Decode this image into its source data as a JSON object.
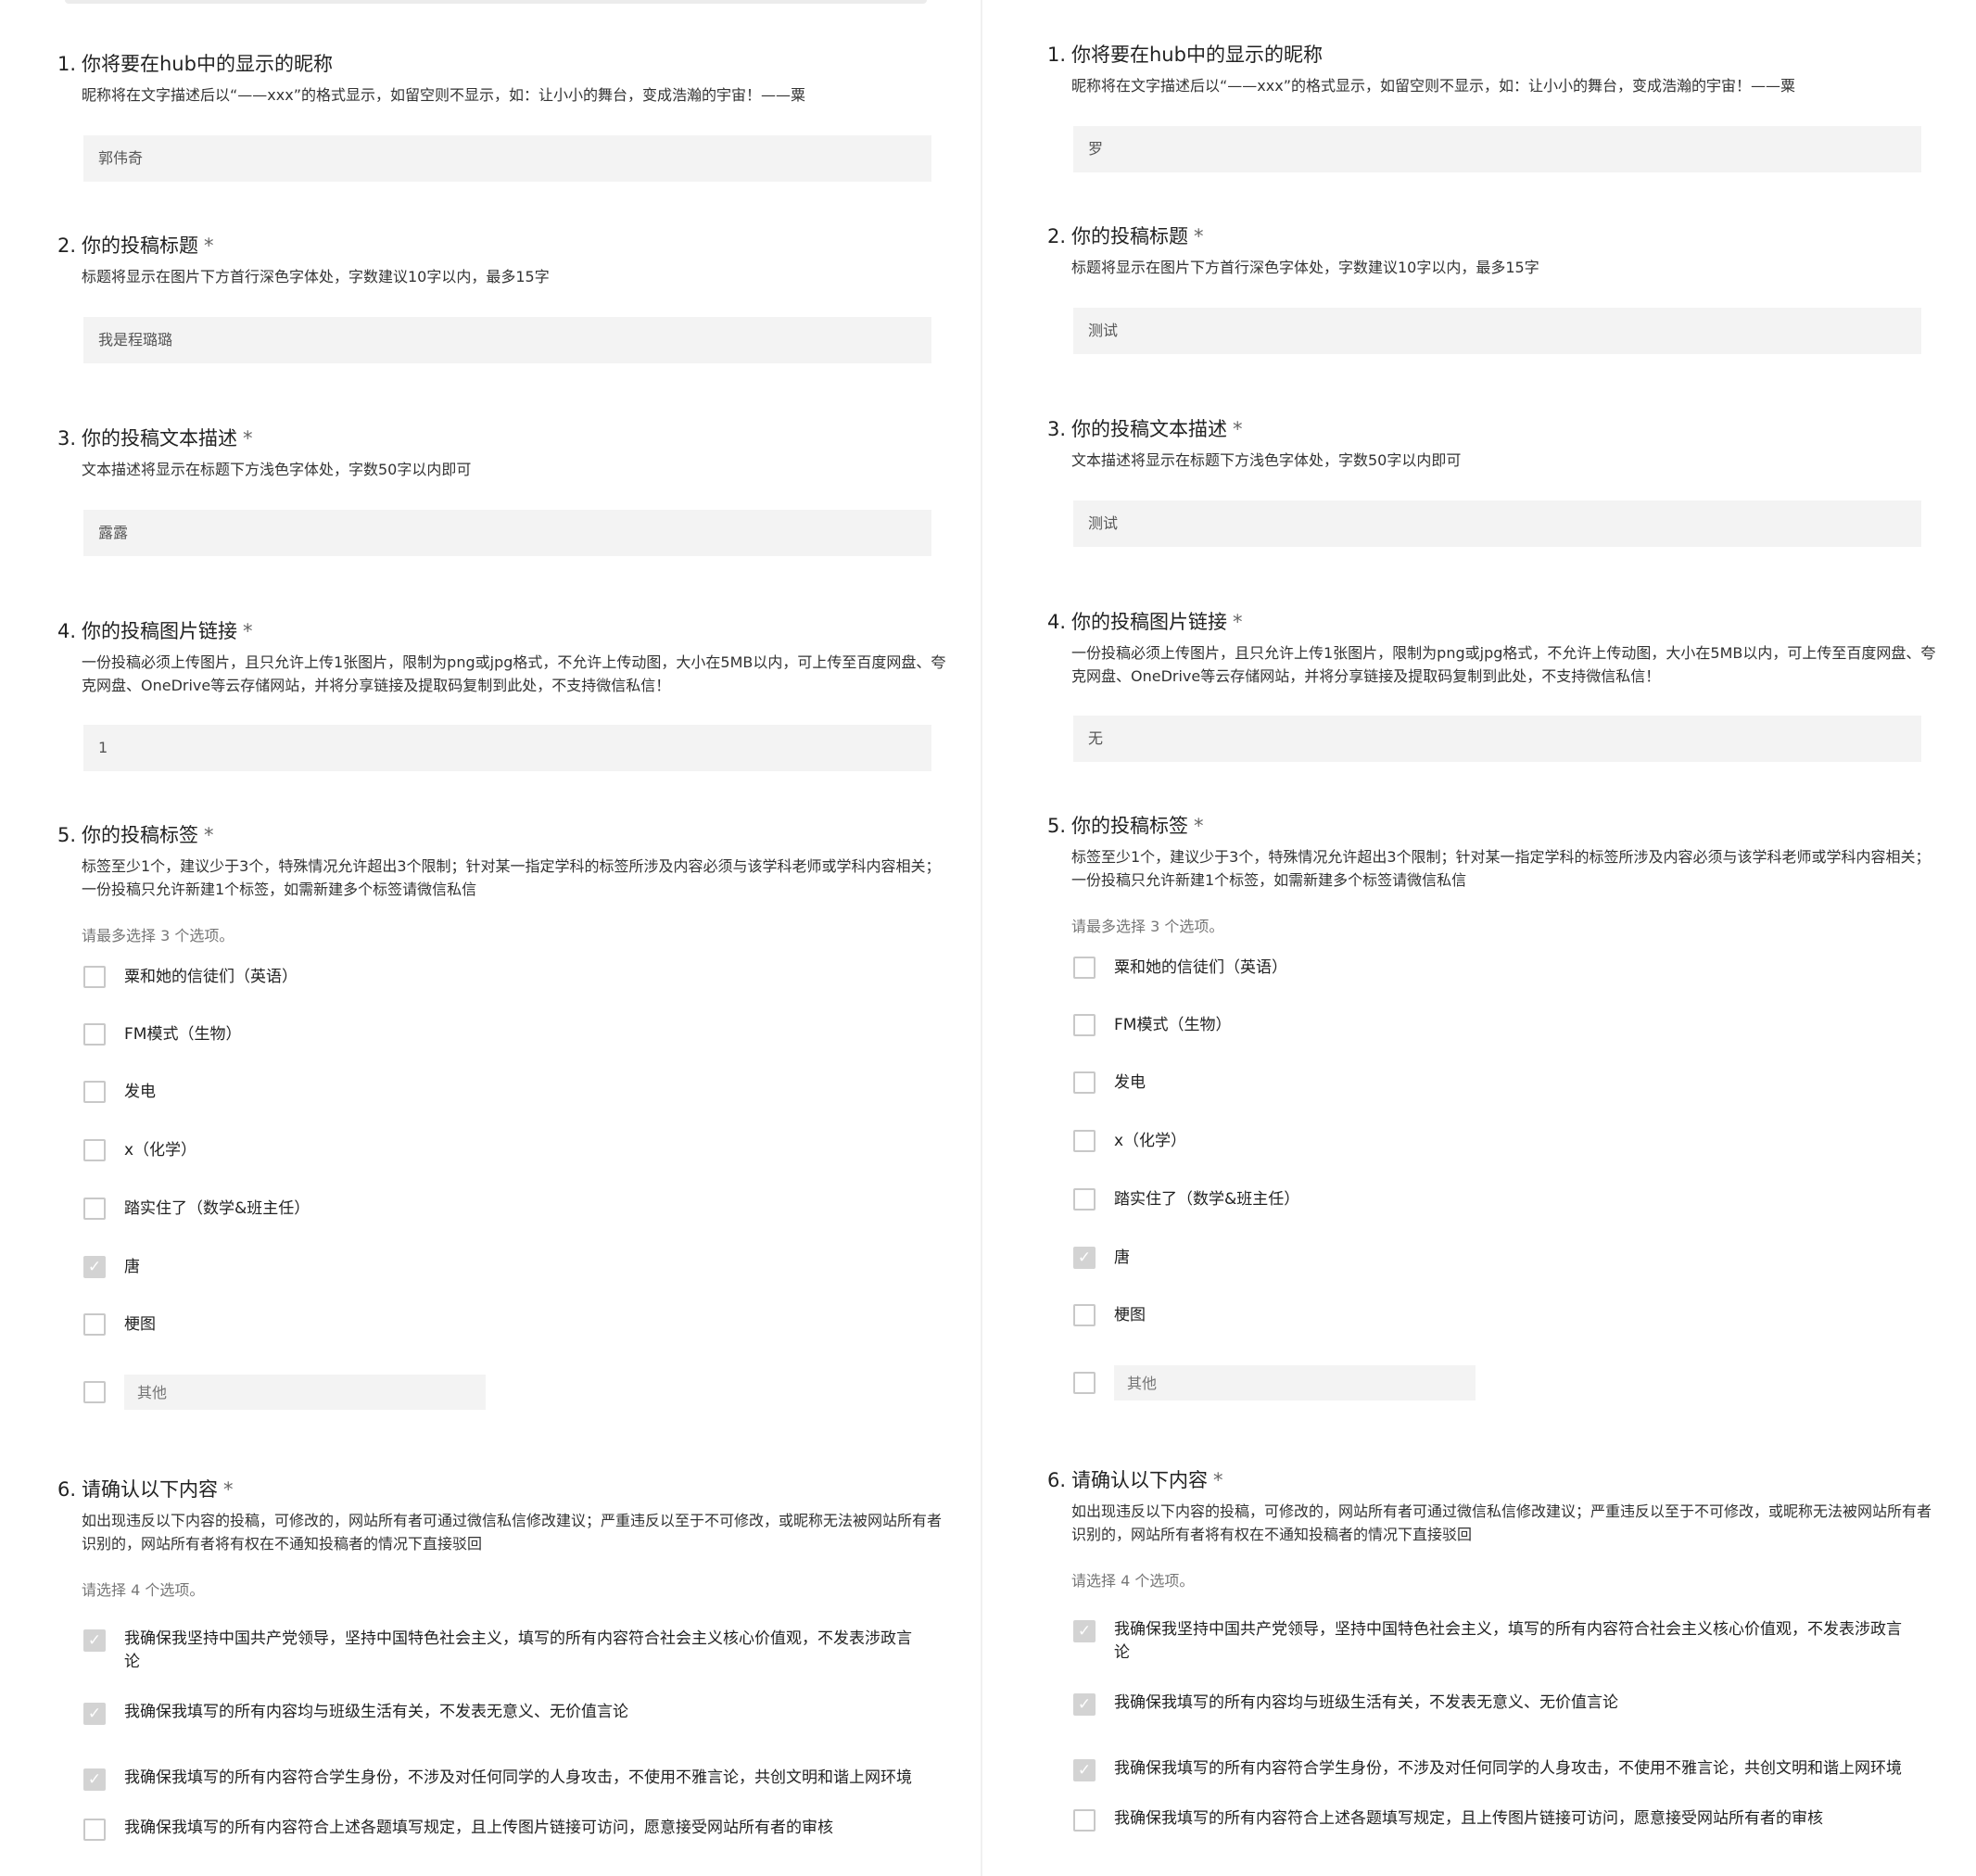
{
  "required_mark": "*",
  "forms": [
    {
      "questions": [
        {
          "num": "1.",
          "title": "你将要在hub中的显示的昵称",
          "required": false,
          "desc": "昵称将在文字描述后以“——xxx”的格式显示，如留空则不显示，如：让小小的舞台，变成浩瀚的宇宙！——粟",
          "answer": "郭伟奇"
        },
        {
          "num": "2.",
          "title": "你的投稿标题",
          "required": true,
          "desc": "标题将显示在图片下方首行深色字体处，字数建议10字以内，最多15字",
          "answer": "我是程璐璐"
        },
        {
          "num": "3.",
          "title": "你的投稿文本描述",
          "required": true,
          "desc": "文本描述将显示在标题下方浅色字体处，字数50字以内即可",
          "answer": "露露"
        },
        {
          "num": "4.",
          "title": "你的投稿图片链接",
          "required": true,
          "desc": "一份投稿必须上传图片，且只允许上传1张图片，限制为png或jpg格式，不允许上传动图，大小在5MB以内，可上传至百度网盘、夸克网盘、OneDrive等云存储网站，并将分享链接及提取码复制到此处，不支持微信私信！",
          "answer": "1"
        },
        {
          "num": "5.",
          "title": "你的投稿标签",
          "required": true,
          "desc": "标签至少1个，建议少于3个，特殊情况允许超出3个限制；针对某一指定学科的标签所涉及内容必须与该学科老师或学科内容相关；一份投稿只允许新建1个标签，如需新建多个标签请微信私信",
          "hint": "请最多选择 3 个选项。",
          "options": [
            {
              "label": "粟和她的信徒们（英语）",
              "checked": false
            },
            {
              "label": "FM模式（生物）",
              "checked": false
            },
            {
              "label": "发电",
              "checked": false
            },
            {
              "label": "x（化学）",
              "checked": false
            },
            {
              "label": "踏实住了（数学&班主任）",
              "checked": false
            },
            {
              "label": "唐",
              "checked": true
            },
            {
              "label": "梗图",
              "checked": false
            }
          ],
          "other_placeholder": "其他"
        },
        {
          "num": "6.",
          "title": "请确认以下内容",
          "required": true,
          "desc": "如出现违反以下内容的投稿，可修改的，网站所有者可通过微信私信修改建议；严重违反以至于不可修改，或昵称无法被网站所有者识别的，网站所有者将有权在不通知投稿者的情况下直接驳回",
          "hint": "请选择 4 个选项。",
          "options": [
            {
              "label": "我确保我坚持中国共产党领导，坚持中国特色社会主义，填写的所有内容符合社会主义核心价值观，不发表涉政言论",
              "checked": true
            },
            {
              "label": "我确保我填写的所有内容均与班级生活有关，不发表无意义、无价值言论",
              "checked": true
            },
            {
              "label": "我确保我填写的所有内容符合学生身份，不涉及对任何同学的人身攻击，不使用不雅言论，共创文明和谐上网环境",
              "checked": true
            },
            {
              "label": "我确保我填写的所有内容符合上述各题填写规定，且上传图片链接可访问，愿意接受网站所有者的审核",
              "checked": false
            }
          ]
        }
      ]
    },
    {
      "questions": [
        {
          "num": "1.",
          "title": "你将要在hub中的显示的昵称",
          "required": false,
          "desc": "昵称将在文字描述后以“——xxx”的格式显示，如留空则不显示，如：让小小的舞台，变成浩瀚的宇宙！——粟",
          "answer": "罗"
        },
        {
          "num": "2.",
          "title": "你的投稿标题",
          "required": true,
          "desc": "标题将显示在图片下方首行深色字体处，字数建议10字以内，最多15字",
          "answer": "测试"
        },
        {
          "num": "3.",
          "title": "你的投稿文本描述",
          "required": true,
          "desc": "文本描述将显示在标题下方浅色字体处，字数50字以内即可",
          "answer": "测试"
        },
        {
          "num": "4.",
          "title": "你的投稿图片链接",
          "required": true,
          "desc": "一份投稿必须上传图片，且只允许上传1张图片，限制为png或jpg格式，不允许上传动图，大小在5MB以内，可上传至百度网盘、夸克网盘、OneDrive等云存储网站，并将分享链接及提取码复制到此处，不支持微信私信！",
          "answer": "无"
        },
        {
          "num": "5.",
          "title": "你的投稿标签",
          "required": true,
          "desc": "标签至少1个，建议少于3个，特殊情况允许超出3个限制；针对某一指定学科的标签所涉及内容必须与该学科老师或学科内容相关；一份投稿只允许新建1个标签，如需新建多个标签请微信私信",
          "hint": "请最多选择 3 个选项。",
          "options": [
            {
              "label": "粟和她的信徒们（英语）",
              "checked": false
            },
            {
              "label": "FM模式（生物）",
              "checked": false
            },
            {
              "label": "发电",
              "checked": false
            },
            {
              "label": "x（化学）",
              "checked": false
            },
            {
              "label": "踏实住了（数学&班主任）",
              "checked": false
            },
            {
              "label": "唐",
              "checked": true
            },
            {
              "label": "梗图",
              "checked": false
            }
          ],
          "other_placeholder": "其他"
        },
        {
          "num": "6.",
          "title": "请确认以下内容",
          "required": true,
          "desc": "如出现违反以下内容的投稿，可修改的，网站所有者可通过微信私信修改建议；严重违反以至于不可修改，或昵称无法被网站所有者识别的，网站所有者将有权在不通知投稿者的情况下直接驳回",
          "hint": "请选择 4 个选项。",
          "options": [
            {
              "label": "我确保我坚持中国共产党领导，坚持中国特色社会主义，填写的所有内容符合社会主义核心价值观，不发表涉政言论",
              "checked": true
            },
            {
              "label": "我确保我填写的所有内容均与班级生活有关，不发表无意义、无价值言论",
              "checked": true
            },
            {
              "label": "我确保我填写的所有内容符合学生身份，不涉及对任何同学的人身攻击，不使用不雅言论，共创文明和谐上网环境",
              "checked": true
            },
            {
              "label": "我确保我填写的所有内容符合上述各题填写规定，且上传图片链接可访问，愿意接受网站所有者的审核",
              "checked": false
            }
          ]
        }
      ]
    }
  ]
}
